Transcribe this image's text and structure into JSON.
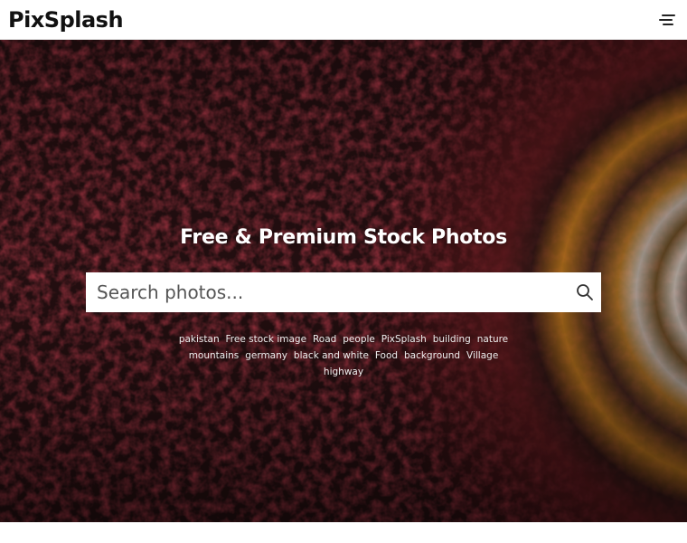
{
  "header": {
    "logo": "PixSplash",
    "menu_icon": "hamburger-menu-icon"
  },
  "hero": {
    "headline": "Free & Premium Stock Photos",
    "search": {
      "placeholder": "Search photos...",
      "value": "",
      "icon": "search-icon"
    },
    "tags": [
      "pakistan",
      "Free stock image",
      "Road",
      "people",
      "PixSplash",
      "building",
      "nature",
      "mountains",
      "germany",
      "black and white",
      "Food",
      "background",
      "Village",
      "highway"
    ]
  }
}
